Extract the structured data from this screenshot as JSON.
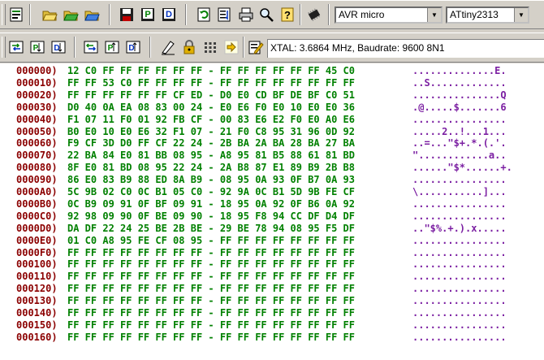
{
  "toolbar1": {
    "buttons": [
      "program-icon",
      "open-icon",
      "open-green-icon",
      "open-blue-icon",
      "save-icon",
      "save-p-icon",
      "save-d-icon",
      "refresh-icon",
      "list-icon",
      "print-icon",
      "search-icon",
      "help-icon",
      "chip-icon"
    ],
    "device_family": "AVR micro",
    "device": "ATtiny2313"
  },
  "toolbar2": {
    "buttons": [
      "read-chip-icon",
      "read-program-icon",
      "read-data-icon",
      "write-chip-icon",
      "write-program-icon",
      "write-data-icon",
      "erase-icon",
      "lock-icon",
      "fuse-icon",
      "arrow-icon",
      "edit-config-icon"
    ],
    "info": "XTAL: 3.6864 MHz, Baudrate: 9600 8N1"
  },
  "hex_rows": [
    {
      "addr": "000000)",
      "hex": "12 C0 FF FF FF FF FF FF - FF FF FF FF FF FF 45 C0",
      "ascii": "..............E."
    },
    {
      "addr": "000010)",
      "hex": "FF FF 53 C0 FF FF FF FF - FF FF FF FF FF FF FF FF",
      "ascii": "..S............."
    },
    {
      "addr": "000020)",
      "hex": "FF FF FF FF FF FF CF ED - D0 E0 CD BF DE BF C0 51",
      "ascii": "...............Q"
    },
    {
      "addr": "000030)",
      "hex": "D0 40 0A EA 08 83 00 24 - E0 E6 F0 E0 10 E0 E0 36",
      "ascii": ".@.....$.......6"
    },
    {
      "addr": "000040)",
      "hex": "F1 07 11 F0 01 92 FB CF - 00 83 E6 E2 F0 E0 A0 E6",
      "ascii": "................"
    },
    {
      "addr": "000050)",
      "hex": "B0 E0 10 E0 E6 32 F1 07 - 21 F0 C8 95 31 96 0D 92",
      "ascii": ".....2..!...1..."
    },
    {
      "addr": "000060)",
      "hex": "F9 CF 3D D0 FF CF 22 24 - 2B BA 2A BA 28 BA 27 BA",
      "ascii": "..=...\"$+.*.(.'."
    },
    {
      "addr": "000070)",
      "hex": "22 BA 84 E0 81 BB 08 95 - A8 95 81 B5 88 61 81 BD",
      "ascii": "\"............a.."
    },
    {
      "addr": "000080)",
      "hex": "8F E0 81 BD 08 95 22 24 - 2A B8 87 E1 89 B9 2B B8",
      "ascii": "......\"$*......+."
    },
    {
      "addr": "000090)",
      "hex": "86 E0 83 B9 88 ED 8A B9 - 08 95 0A 93 0F B7 0A 93",
      "ascii": "................"
    },
    {
      "addr": "0000A0)",
      "hex": "5C 9B 02 C0 0C B1 05 C0 - 92 9A 0C B1 5D 9B FE CF",
      "ascii": "\\...........]..."
    },
    {
      "addr": "0000B0)",
      "hex": "0C B9 09 91 0F BF 09 91 - 18 95 0A 92 0F B6 0A 92",
      "ascii": "................"
    },
    {
      "addr": "0000C0)",
      "hex": "92 98 09 90 0F BE 09 90 - 18 95 F8 94 CC DF D4 DF",
      "ascii": "................"
    },
    {
      "addr": "0000D0)",
      "hex": "DA DF 22 24 25 BE 2B BE - 29 BE 78 94 08 95 F5 DF",
      "ascii": "..\"$%.+.).x....."
    },
    {
      "addr": "0000E0)",
      "hex": "01 C0 A8 95 FE CF 08 95 - FF FF FF FF FF FF FF FF",
      "ascii": "................"
    },
    {
      "addr": "0000F0)",
      "hex": "FF FF FF FF FF FF FF FF - FF FF FF FF FF FF FF FF",
      "ascii": "................"
    },
    {
      "addr": "000100)",
      "hex": "FF FF FF FF FF FF FF FF - FF FF FF FF FF FF FF FF",
      "ascii": "................"
    },
    {
      "addr": "000110)",
      "hex": "FF FF FF FF FF FF FF FF - FF FF FF FF FF FF FF FF",
      "ascii": "................"
    },
    {
      "addr": "000120)",
      "hex": "FF FF FF FF FF FF FF FF - FF FF FF FF FF FF FF FF",
      "ascii": "................"
    },
    {
      "addr": "000130)",
      "hex": "FF FF FF FF FF FF FF FF - FF FF FF FF FF FF FF FF",
      "ascii": "................"
    },
    {
      "addr": "000140)",
      "hex": "FF FF FF FF FF FF FF FF - FF FF FF FF FF FF FF FF",
      "ascii": "................"
    },
    {
      "addr": "000150)",
      "hex": "FF FF FF FF FF FF FF FF - FF FF FF FF FF FF FF FF",
      "ascii": "................"
    },
    {
      "addr": "000160)",
      "hex": "FF FF FF FF FF FF FF FF - FF FF FF FF FF FF FF FF",
      "ascii": "................"
    }
  ],
  "colors": {
    "address": "#8b0000",
    "hex": "#008000",
    "ascii": "#7b1fa2",
    "background": "#ffffff",
    "toolbar": "#d4d0c8"
  }
}
